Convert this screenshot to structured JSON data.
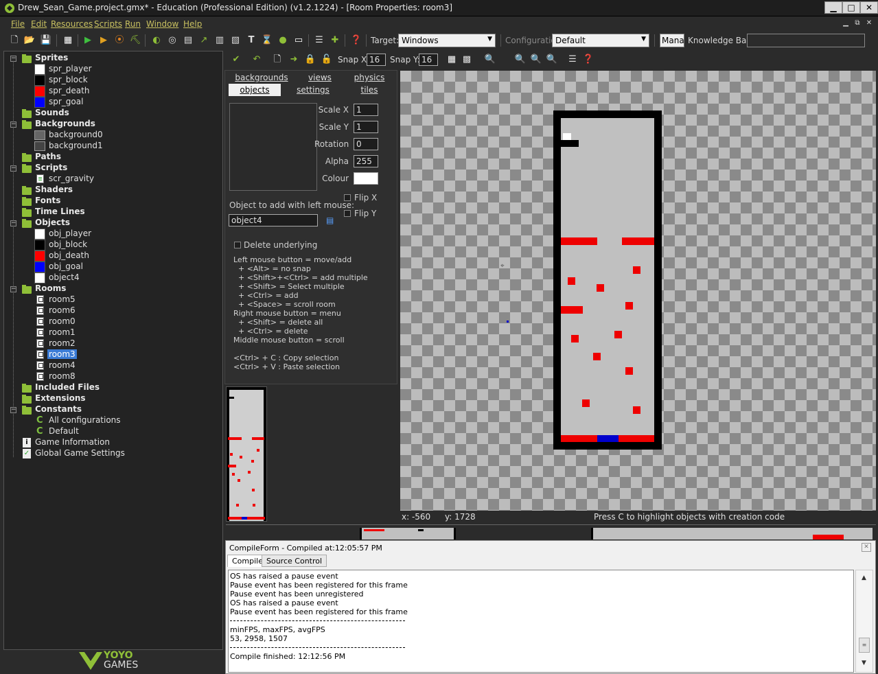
{
  "window": {
    "title": "Drew_Sean_Game.project.gmx*  -  Education (Professional Edition)  (v1.2.1224) - [Room Properties: room3]",
    "minimize": "▁",
    "maximize": "□",
    "close": "✕"
  },
  "menu": [
    "File",
    "Edit",
    "Resources",
    "Scripts",
    "Run",
    "Window",
    "Help"
  ],
  "mdi_controls": [
    "▁",
    "⧉",
    "✕"
  ],
  "toolbar": {
    "target_label": "Target:",
    "target_value": "Windows",
    "configuration_label": "Configuration",
    "configuration_value": "Default",
    "manage_label": "Manag",
    "knowledge_base_label": "Knowledge Base:",
    "knowledge_base_value": ""
  },
  "tree": {
    "sprites": "Sprites",
    "sprite_items": [
      {
        "label": "spr_player",
        "color": "#ffffff"
      },
      {
        "label": "spr_block",
        "color": "#000000"
      },
      {
        "label": "spr_death",
        "color": "#ff0000"
      },
      {
        "label": "spr_goal",
        "color": "#0000ff"
      }
    ],
    "sounds": "Sounds",
    "backgrounds": "Backgrounds",
    "background_items": [
      "background0",
      "background1"
    ],
    "paths": "Paths",
    "scripts": "Scripts",
    "script_items": [
      "scr_gravity"
    ],
    "shaders": "Shaders",
    "fonts": "Fonts",
    "time_lines": "Time Lines",
    "objects": "Objects",
    "object_items": [
      {
        "label": "obj_player",
        "color": "#ffffff"
      },
      {
        "label": "obj_block",
        "color": "#000000"
      },
      {
        "label": "obj_death",
        "color": "#ff0000"
      },
      {
        "label": "obj_goal",
        "color": "#0000ff"
      },
      {
        "label": "object4",
        "color": "#ffffff"
      }
    ],
    "rooms": "Rooms",
    "room_items": [
      "room5",
      "room6",
      "room0",
      "room1",
      "room2",
      "room3",
      "room4",
      "room8"
    ],
    "selected_room": "room3",
    "included_files": "Included Files",
    "extensions": "Extensions",
    "constants": "Constants",
    "constant_items": [
      "All configurations",
      "Default"
    ],
    "game_information": "Game Information",
    "global_game_settings": "Global Game Settings"
  },
  "logo": {
    "line1": "YOYO",
    "line2": "GAMES"
  },
  "room_panel": {
    "tabs_row1": [
      "backgrounds",
      "views",
      "physics"
    ],
    "tabs_row2": [
      "objects",
      "settings",
      "tiles"
    ],
    "active_tab": "objects",
    "scale_x_label": "Scale X",
    "scale_x": "1",
    "scale_y_label": "Scale Y",
    "scale_y": "1",
    "rotation_label": "Rotation",
    "rotation": "0",
    "alpha_label": "Alpha",
    "alpha": "255",
    "colour_label": "Colour",
    "colour": "#ffffff",
    "flip_x_label": "Flip X",
    "flip_y_label": "Flip Y",
    "object_to_add_label": "Object to add with left mouse:",
    "object_to_add_value": "object4",
    "delete_underlying_label": "Delete underlying",
    "help_lines": [
      "Left mouse button = move/add",
      "  + <Alt> = no snap",
      "  + <Shift>+<Ctrl> = add multiple",
      "  + <Shift> = Select multiple",
      "  + <Ctrl> = add",
      "  + <Space> = scroll room",
      "Right mouse button = menu",
      "  + <Shift> = delete all",
      "  + <Ctrl> = delete",
      "Middle mouse button = scroll",
      "",
      "<Ctrl> + C : Copy selection",
      "<Ctrl> + V : Paste selection"
    ]
  },
  "editor_toolbar": {
    "snap_x_label": "Snap X:",
    "snap_x": "16",
    "snap_y_label": "Snap Y:",
    "snap_y": "16"
  },
  "status": {
    "x": "x: -560",
    "y": "y: 1728",
    "hint": "Press C to highlight objects with creation code"
  },
  "compile": {
    "header": "CompileForm - Compiled at:12:05:57 PM",
    "tabs": [
      "Compile",
      "Source Control"
    ],
    "lines": [
      "OS has raised a pause event",
      "Pause event has been registered for this frame",
      "Pause event has been unregistered",
      "OS has raised a pause event",
      "Pause event has been registered for this frame"
    ],
    "fps_header": "minFPS, maxFPS, avgFPS",
    "fps_values": "53, 2958, 1507",
    "finished": "Compile finished: 12:12:56 PM"
  },
  "colors": {
    "accent_green": "#8fbf38",
    "death_red": "#ff0000",
    "goal_blue": "#0000ff",
    "menu_yellow": "#c8c060",
    "selection_blue": "#3a7bd5"
  }
}
